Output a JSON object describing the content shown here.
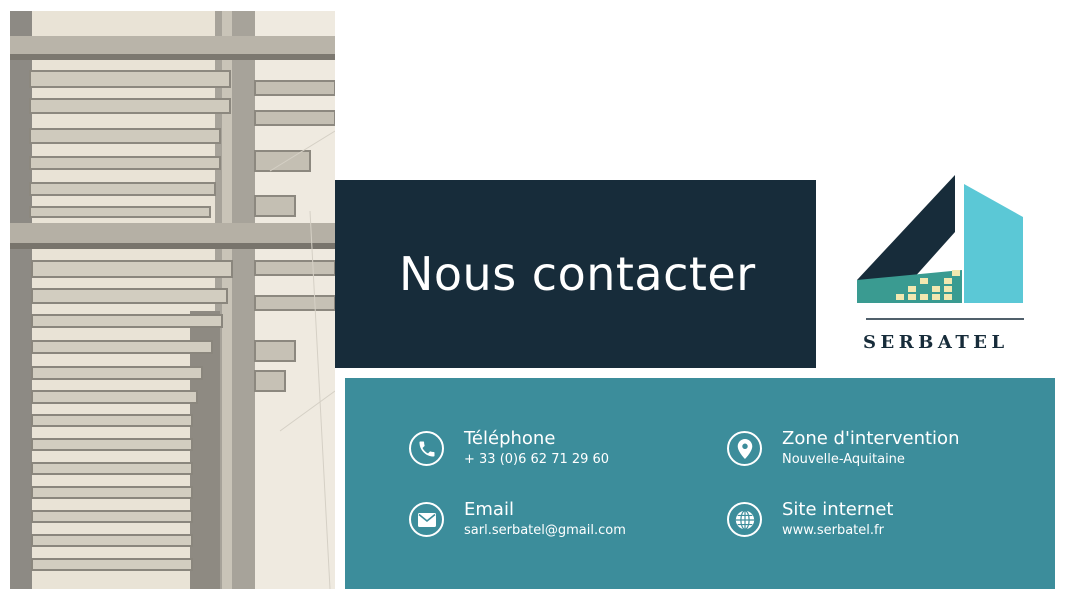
{
  "title": "Nous contacter",
  "logo": {
    "name": "SERBATEL"
  },
  "contacts": [
    {
      "label": "Téléphone",
      "value": "+ 33 (0)6 62 71 29 60",
      "icon": "phone-icon"
    },
    {
      "label": "Zone d'intervention",
      "value": "Nouvelle-Aquitaine",
      "icon": "map-pin-icon"
    },
    {
      "label": "Email",
      "value": "sarl.serbatel@gmail.com",
      "icon": "mail-icon"
    },
    {
      "label": "Site internet",
      "value": "www.serbatel.fr",
      "icon": "globe-icon"
    }
  ],
  "colors": {
    "dark_navy": "#172c3a",
    "teal": "#3c8d9b",
    "logo_light_blue": "#5bc8d6",
    "logo_teal": "#3a9b91",
    "logo_windows": "#f2e8b0"
  }
}
